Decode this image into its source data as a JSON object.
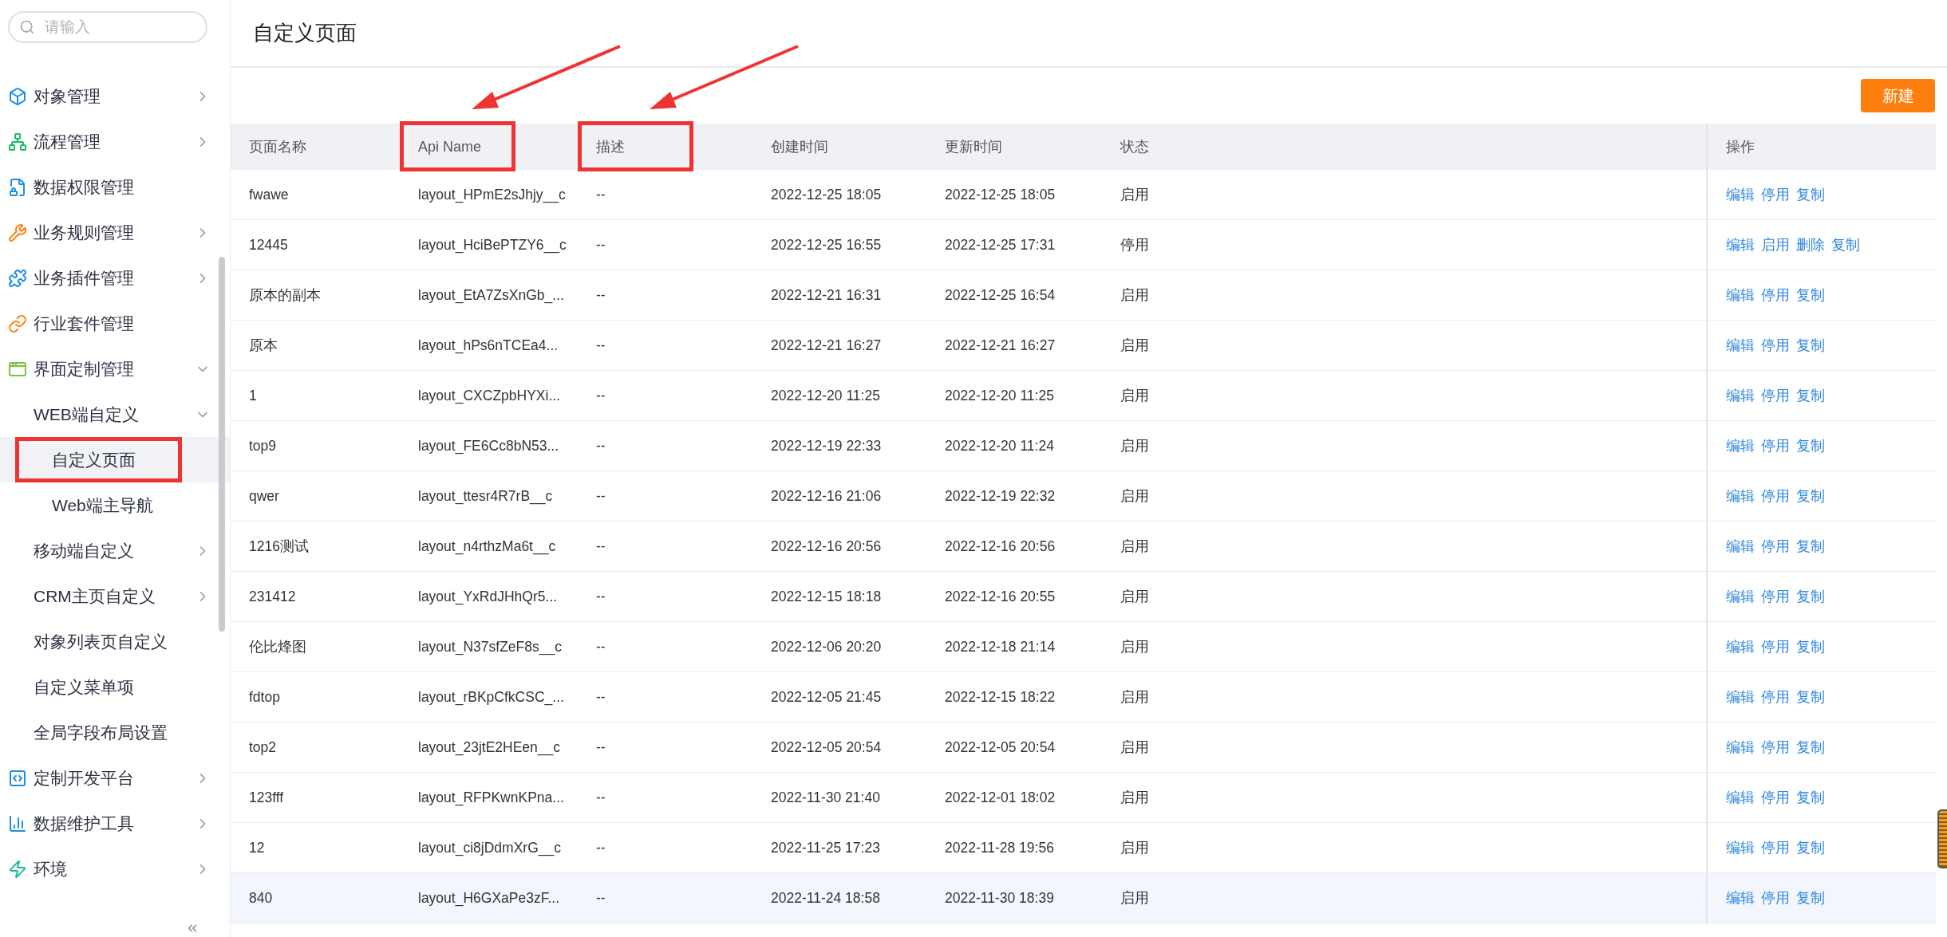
{
  "sidebar": {
    "search": {
      "placeholder": "请输入"
    },
    "items": [
      {
        "label": "对象管理",
        "kind": "group",
        "expanded": false,
        "selected": false,
        "annotated": false
      },
      {
        "label": "流程管理",
        "kind": "group",
        "expanded": false,
        "selected": false,
        "annotated": false
      },
      {
        "label": "数据权限管理",
        "kind": "link",
        "selected": false,
        "annotated": false
      },
      {
        "label": "业务规则管理",
        "kind": "group",
        "expanded": false,
        "selected": false,
        "annotated": false
      },
      {
        "label": "业务插件管理",
        "kind": "group",
        "expanded": false,
        "selected": false,
        "annotated": false
      },
      {
        "label": "行业套件管理",
        "kind": "link",
        "selected": false,
        "annotated": false
      },
      {
        "label": "界面定制管理",
        "kind": "group",
        "expanded": true,
        "selected": false,
        "annotated": false,
        "children": [
          {
            "label": "WEB端自定义",
            "kind": "group",
            "expanded": true,
            "selected": false,
            "annotated": false,
            "children": [
              {
                "label": "自定义页面",
                "selected": true,
                "annotated": true
              },
              {
                "label": "Web端主导航",
                "selected": false,
                "annotated": false
              }
            ]
          },
          {
            "label": "移动端自定义",
            "kind": "group",
            "expanded": false,
            "selected": false,
            "annotated": false
          },
          {
            "label": "CRM主页自定义",
            "kind": "group",
            "expanded": false,
            "selected": false,
            "annotated": false
          },
          {
            "label": "对象列表页自定义",
            "kind": "link",
            "selected": false,
            "annotated": false
          },
          {
            "label": "自定义菜单项",
            "kind": "link",
            "selected": false,
            "annotated": false
          },
          {
            "label": "全局字段布局设置",
            "kind": "link",
            "selected": false,
            "annotated": false
          }
        ]
      },
      {
        "label": "定制开发平台",
        "kind": "group",
        "expanded": false,
        "selected": false,
        "annotated": false
      },
      {
        "label": "数据维护工具",
        "kind": "group",
        "expanded": false,
        "selected": false,
        "annotated": false
      },
      {
        "label": "环境",
        "kind": "group",
        "expanded": false,
        "selected": false,
        "annotated": false
      }
    ]
  },
  "page": {
    "title": "自定义页面",
    "new_button": "新建"
  },
  "table": {
    "columns": [
      {
        "label": "页面名称",
        "annotated": false
      },
      {
        "label": "Api Name",
        "annotated": true
      },
      {
        "label": "描述",
        "annotated": true
      },
      {
        "label": "创建时间",
        "annotated": false
      },
      {
        "label": "更新时间",
        "annotated": false
      },
      {
        "label": "状态",
        "annotated": false
      },
      {
        "label": "操作",
        "annotated": false
      }
    ],
    "rows": [
      {
        "name": "fwawe",
        "api_name": "layout_HPmE2sJhjy__c",
        "description": "--",
        "created": "2022-12-25 18:05",
        "updated": "2022-12-25 18:05",
        "status": "启用",
        "highlighted": false,
        "actions": [
          "编辑",
          "停用",
          "复制"
        ]
      },
      {
        "name": "12445",
        "api_name": "layout_HciBePTZY6__c",
        "description": "--",
        "created": "2022-12-25 16:55",
        "updated": "2022-12-25 17:31",
        "status": "停用",
        "highlighted": false,
        "actions": [
          "编辑",
          "启用",
          "删除",
          "复制"
        ]
      },
      {
        "name": "原本的副本",
        "api_name": "layout_EtA7ZsXnGb_...",
        "description": "--",
        "created": "2022-12-21 16:31",
        "updated": "2022-12-25 16:54",
        "status": "启用",
        "highlighted": false,
        "actions": [
          "编辑",
          "停用",
          "复制"
        ]
      },
      {
        "name": "原本",
        "api_name": "layout_hPs6nTCEa4...",
        "description": "--",
        "created": "2022-12-21 16:27",
        "updated": "2022-12-21 16:27",
        "status": "启用",
        "highlighted": false,
        "actions": [
          "编辑",
          "停用",
          "复制"
        ]
      },
      {
        "name": "1",
        "api_name": "layout_CXCZpbHYXi...",
        "description": "--",
        "created": "2022-12-20 11:25",
        "updated": "2022-12-20 11:25",
        "status": "启用",
        "highlighted": false,
        "actions": [
          "编辑",
          "停用",
          "复制"
        ]
      },
      {
        "name": "top9",
        "api_name": "layout_FE6Cc8bN53...",
        "description": "--",
        "created": "2022-12-19 22:33",
        "updated": "2022-12-20 11:24",
        "status": "启用",
        "highlighted": false,
        "actions": [
          "编辑",
          "停用",
          "复制"
        ]
      },
      {
        "name": "qwer",
        "api_name": "layout_ttesr4R7rB__c",
        "description": "--",
        "created": "2022-12-16 21:06",
        "updated": "2022-12-19 22:32",
        "status": "启用",
        "highlighted": false,
        "actions": [
          "编辑",
          "停用",
          "复制"
        ]
      },
      {
        "name": "1216测试",
        "api_name": "layout_n4rthzMa6t__c",
        "description": "--",
        "created": "2022-12-16 20:56",
        "updated": "2022-12-16 20:56",
        "status": "启用",
        "highlighted": false,
        "actions": [
          "编辑",
          "停用",
          "复制"
        ]
      },
      {
        "name": "231412",
        "api_name": "layout_YxRdJHhQr5...",
        "description": "--",
        "created": "2022-12-15 18:18",
        "updated": "2022-12-16 20:55",
        "status": "启用",
        "highlighted": false,
        "actions": [
          "编辑",
          "停用",
          "复制"
        ]
      },
      {
        "name": "伦比烽图",
        "api_name": "layout_N37sfZeF8s__c",
        "description": "--",
        "created": "2022-12-06 20:20",
        "updated": "2022-12-18 21:14",
        "status": "启用",
        "highlighted": false,
        "actions": [
          "编辑",
          "停用",
          "复制"
        ]
      },
      {
        "name": "fdtop",
        "api_name": "layout_rBKpCfkCSC_...",
        "description": "--",
        "created": "2022-12-05 21:45",
        "updated": "2022-12-15 18:22",
        "status": "启用",
        "highlighted": false,
        "actions": [
          "编辑",
          "停用",
          "复制"
        ]
      },
      {
        "name": "top2",
        "api_name": "layout_23jtE2HEen__c",
        "description": "--",
        "created": "2022-12-05 20:54",
        "updated": "2022-12-05 20:54",
        "status": "启用",
        "highlighted": false,
        "actions": [
          "编辑",
          "停用",
          "复制"
        ]
      },
      {
        "name": "123fff",
        "api_name": "layout_RFPKwnKPna...",
        "description": "--",
        "created": "2022-11-30 21:40",
        "updated": "2022-12-01 18:02",
        "status": "启用",
        "highlighted": false,
        "actions": [
          "编辑",
          "停用",
          "复制"
        ]
      },
      {
        "name": "12",
        "api_name": "layout_ci8jDdmXrG__c",
        "description": "--",
        "created": "2022-11-25 17:23",
        "updated": "2022-11-28 19:56",
        "status": "启用",
        "highlighted": false,
        "actions": [
          "编辑",
          "停用",
          "复制"
        ]
      },
      {
        "name": "840",
        "api_name": "layout_H6GXaPe3zF...",
        "description": "--",
        "created": "2022-11-24 18:58",
        "updated": "2022-11-30 18:39",
        "status": "启用",
        "highlighted": true,
        "actions": [
          "编辑",
          "停用",
          "复制"
        ]
      }
    ]
  }
}
